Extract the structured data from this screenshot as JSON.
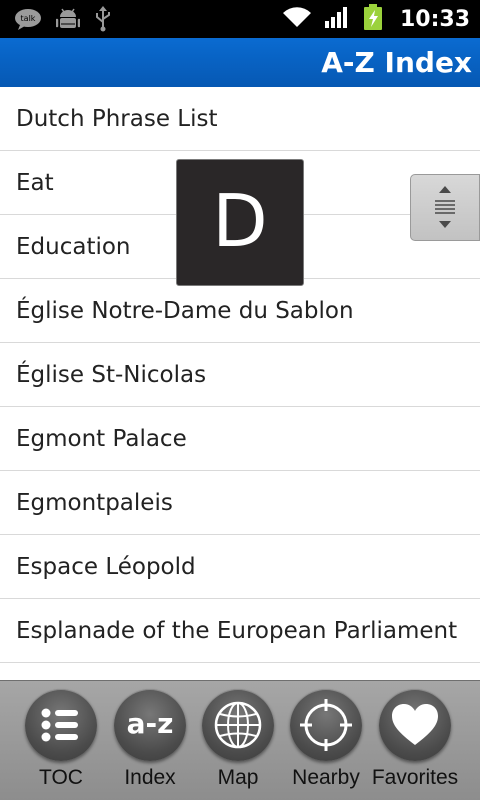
{
  "status_bar": {
    "left_icons": [
      "talk-icon",
      "android-debug-icon",
      "usb-icon"
    ],
    "right_icons": [
      "wifi-icon",
      "signal-icon",
      "battery-charging-icon"
    ],
    "time": "10:33"
  },
  "header": {
    "title": "A-Z Index",
    "color": "#0a63c6"
  },
  "list": {
    "items": [
      "Dutch Phrase List",
      "Eat",
      "Education",
      "Église Notre-Dame du Sablon",
      "Église St-Nicolas",
      "Egmont Palace",
      "Egmontpaleis",
      "Espace Léopold",
      "Esplanade of the European Parliament"
    ]
  },
  "section_indicator": {
    "letter": "D"
  },
  "fast_scroll": {
    "icon": "fast-scroll-handle-icon"
  },
  "bottom_nav": {
    "items": [
      {
        "label": "TOC",
        "icon": "list-icon"
      },
      {
        "label": "Index",
        "icon": "a-z-icon",
        "icon_text": "a-z"
      },
      {
        "label": "Map",
        "icon": "globe-icon"
      },
      {
        "label": "Nearby",
        "icon": "crosshair-icon"
      },
      {
        "label": "Favorites",
        "icon": "heart-icon"
      }
    ]
  }
}
